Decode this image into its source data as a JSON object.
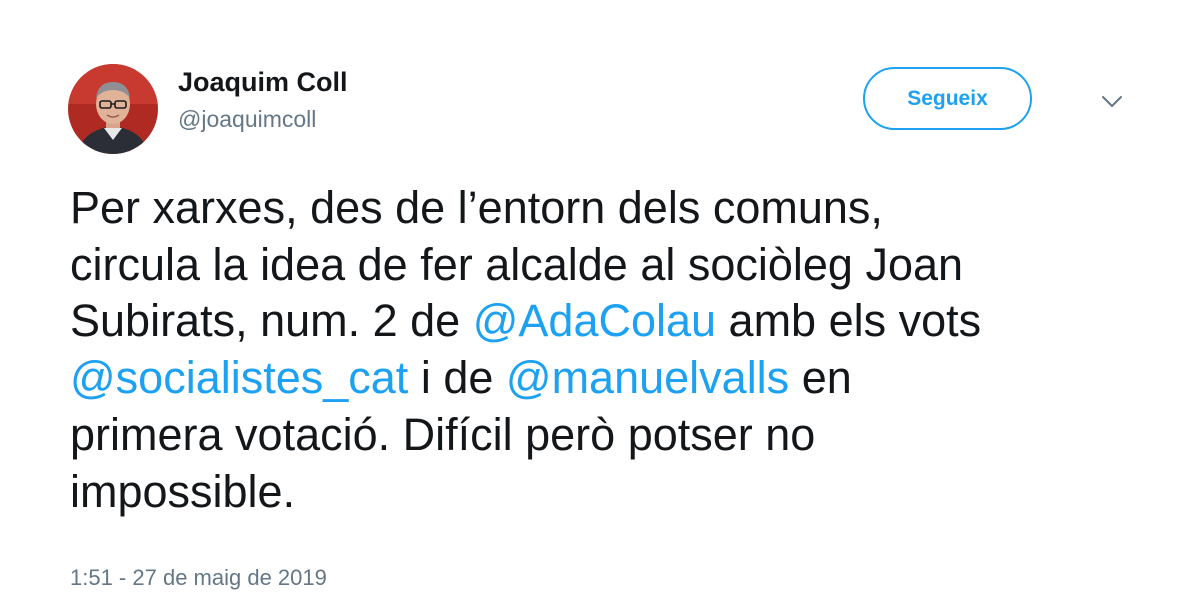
{
  "author": {
    "name": "Joaquim Coll",
    "handle": "@joaquimcoll",
    "avatar_icon": "profile-photo"
  },
  "follow_button": {
    "label": "Segueix",
    "color": "#1da1f2"
  },
  "more_button": {
    "icon": "chevron-down-icon"
  },
  "tweet": {
    "line1": "Per xarxes, des de l’entorn dels comuns,",
    "line2": "circula la idea de fer alcalde al sociòleg Joan",
    "line3_prefix": "Subirats, num. 2 de ",
    "mention_ada": "@AdaColau",
    "line3_suffix": " amb els vots",
    "mention_socialistes": "@socialistes_cat",
    "line4_middle": " i de ",
    "mention_valls": "@manuelvalls",
    "line4_suffix": " en",
    "line5": "primera votació. Difícil però potser no",
    "line6": "impossible."
  },
  "timestamp": "1:51 - 27 de maig de 2019",
  "colors": {
    "link": "#1da1f2",
    "text": "#14171a",
    "secondary": "#657786"
  }
}
